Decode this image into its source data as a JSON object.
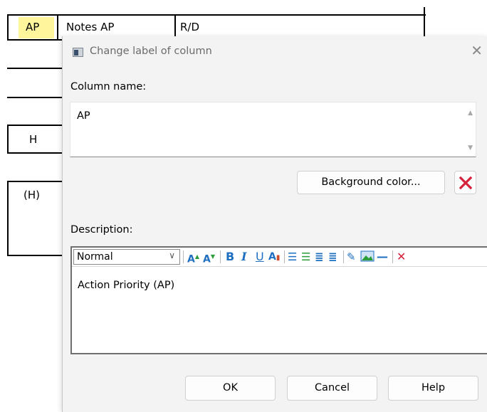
{
  "background": {
    "header_cells": [
      "AP",
      "Notes AP",
      "R/D"
    ],
    "side_cells": [
      "H",
      "(H)"
    ],
    "ap_highlight": "#fff59c"
  },
  "dialog": {
    "title": "Change label of column",
    "title_icon": "window-icon",
    "close_glyph": "✕",
    "column_name_label": "Column name:",
    "column_name_value": "AP",
    "background_color_button": "Background color...",
    "clear_color_icon": "red-x-icon",
    "description_label": "Description:",
    "editor": {
      "style_value": "Normal",
      "text": "Action Priority (AP)",
      "toolbar_icons": [
        "grow-font-icon",
        "shrink-font-icon",
        "bold-icon",
        "italic-icon",
        "underline-icon",
        "font-color-icon",
        "numbered-list-icon",
        "bullet-list-icon",
        "decrease-indent-icon",
        "increase-indent-icon",
        "link-icon",
        "image-icon",
        "horizontal-line-icon",
        "remove-format-icon"
      ]
    },
    "buttons": {
      "ok": "OK",
      "cancel": "Cancel",
      "help": "Help"
    },
    "colors": {
      "accent": "#1f6fc0",
      "danger": "#d6213a",
      "dialog_bg": "#f3f3f3"
    }
  }
}
